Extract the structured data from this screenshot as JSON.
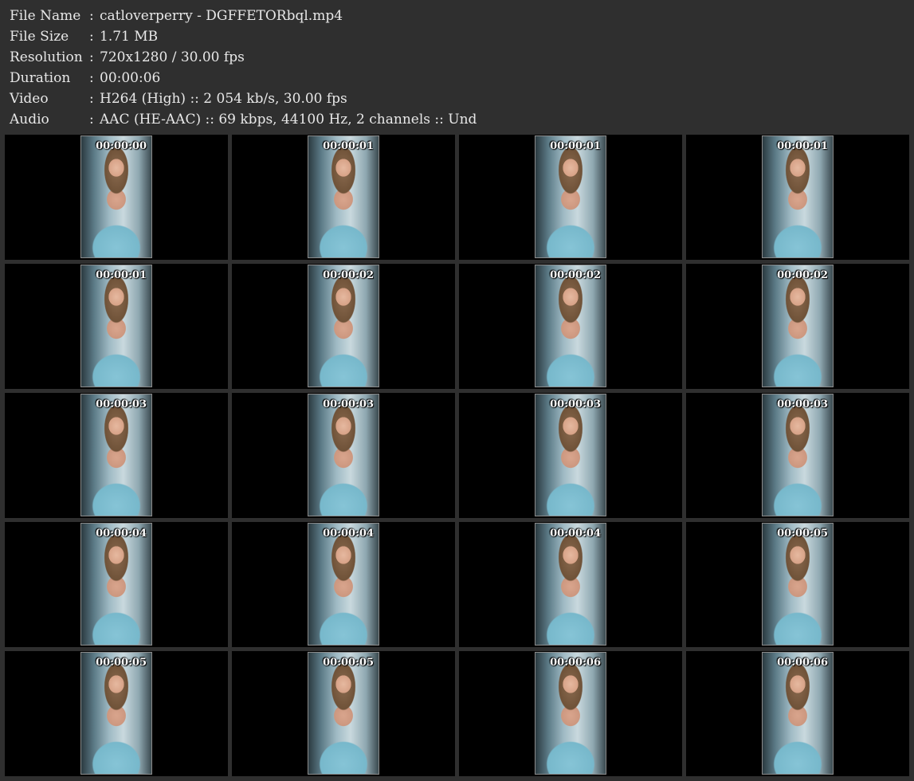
{
  "info": {
    "rows": [
      {
        "label": "File Name",
        "value": "catloverperry - DGFFETORbql.mp4"
      },
      {
        "label": "File Size",
        "value": "1.71 MB"
      },
      {
        "label": "Resolution",
        "value": "720x1280 / 30.00 fps"
      },
      {
        "label": "Duration",
        "value": "00:00:06"
      },
      {
        "label": "Video",
        "value": "H264 (High) :: 2 054 kb/s, 30.00 fps"
      },
      {
        "label": "Audio",
        "value": "AAC (HE-AAC) :: 69 kbps, 44100 Hz, 2 channels :: Und"
      }
    ],
    "separator": ":"
  },
  "thumbnails": {
    "timestamps": [
      "00:00:00",
      "00:00:01",
      "00:00:01",
      "00:00:01",
      "00:00:01",
      "00:00:02",
      "00:00:02",
      "00:00:02",
      "00:00:03",
      "00:00:03",
      "00:00:03",
      "00:00:03",
      "00:00:04",
      "00:00:04",
      "00:00:04",
      "00:00:05",
      "00:00:05",
      "00:00:05",
      "00:00:06",
      "00:00:06"
    ]
  }
}
